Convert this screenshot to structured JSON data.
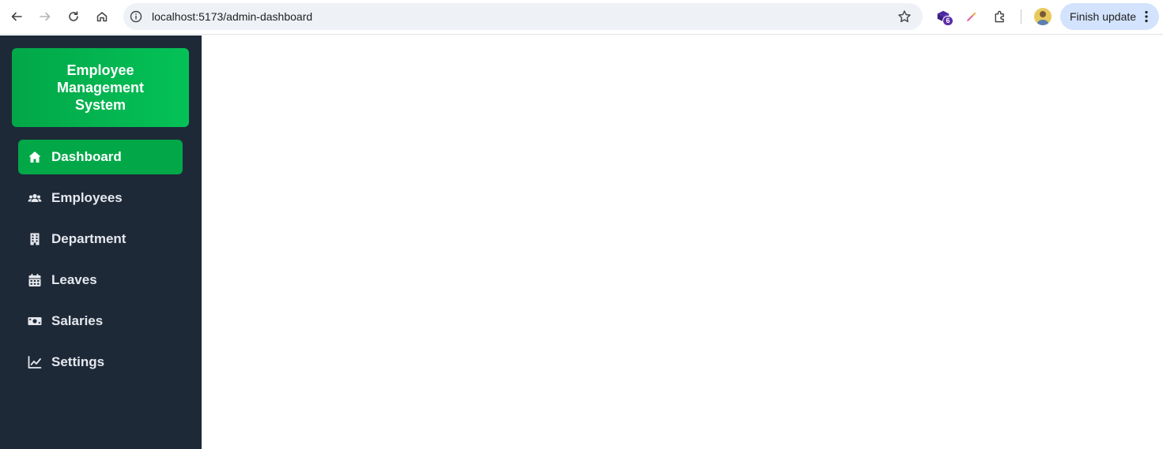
{
  "browser": {
    "url": "localhost:5173/admin-dashboard",
    "extension_badge": "6",
    "finish_update_label": "Finish update"
  },
  "sidebar": {
    "brand_title": "Employee Management System",
    "items": [
      {
        "label": "Dashboard",
        "icon": "home-icon",
        "active": true
      },
      {
        "label": "Employees",
        "icon": "users-icon",
        "active": false
      },
      {
        "label": "Department",
        "icon": "building-icon",
        "active": false
      },
      {
        "label": "Leaves",
        "icon": "calendar-icon",
        "active": false
      },
      {
        "label": "Salaries",
        "icon": "money-icon",
        "active": false
      },
      {
        "label": "Settings",
        "icon": "chart-line-icon",
        "active": false
      }
    ]
  },
  "colors": {
    "sidebar_bg": "#1e2938",
    "accent": "#02a748",
    "brand_gradient_end": "#04c257"
  }
}
